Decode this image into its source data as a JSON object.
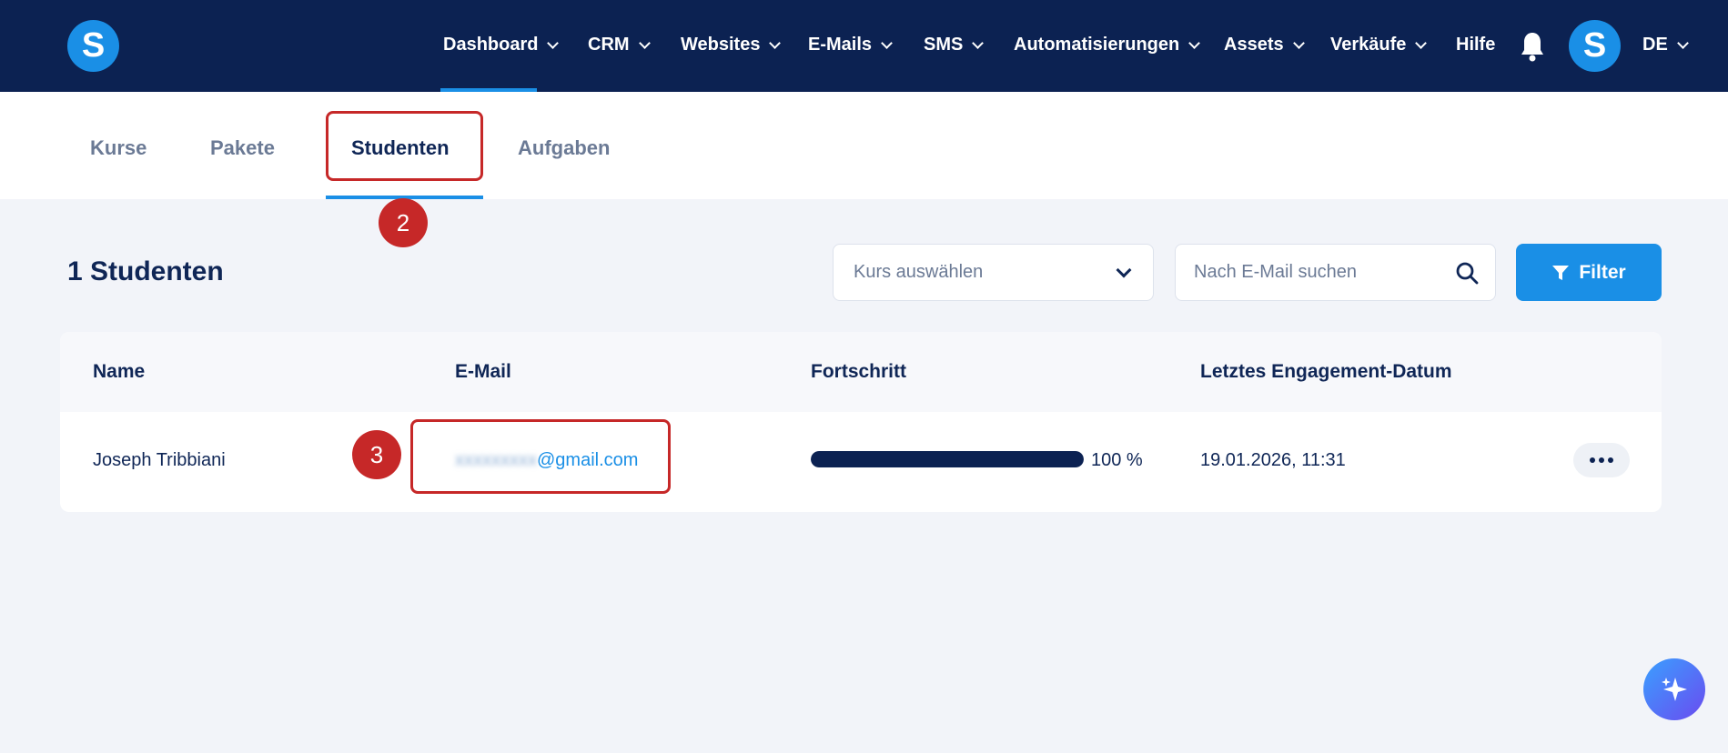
{
  "brand": {
    "logo_letter": "S"
  },
  "nav": {
    "items": [
      {
        "label": "Dashboard",
        "has_dropdown": true
      },
      {
        "label": "CRM",
        "has_dropdown": true
      },
      {
        "label": "Websites",
        "has_dropdown": true
      },
      {
        "label": "E-Mails",
        "has_dropdown": true
      },
      {
        "label": "SMS",
        "has_dropdown": true
      },
      {
        "label": "Automatisierungen",
        "has_dropdown": true
      },
      {
        "label": "Assets",
        "has_dropdown": true
      },
      {
        "label": "Verkäufe",
        "has_dropdown": true
      },
      {
        "label": "Hilfe",
        "has_dropdown": false
      }
    ],
    "avatar_letter": "S",
    "language": "DE"
  },
  "tabs": [
    "Kurse",
    "Pakete",
    "Studenten",
    "Aufgaben"
  ],
  "active_tab": "Studenten",
  "annotations": {
    "step_tab": "2",
    "step_email": "3"
  },
  "page": {
    "title": "1 Studenten",
    "course_select_placeholder": "Kurs auswählen",
    "search_placeholder": "Nach E-Mail suchen",
    "filter_label": "Filter"
  },
  "table": {
    "headers": [
      "Name",
      "E-Mail",
      "Fortschritt",
      "Letztes Engagement-Datum"
    ],
    "rows": [
      {
        "name": "Joseph Tribbiani",
        "email_local": "xxxxxxxxx",
        "email_domain": "@gmail.com",
        "progress": 100,
        "progress_label": "100 %",
        "last_engagement": "19.01.2026, 11:31"
      }
    ]
  },
  "colors": {
    "nav_bg": "#0c2252",
    "accent": "#1a8fe6",
    "annotation_red": "#c62828",
    "page_bg": "#f2f4f9"
  },
  "icons": {
    "bell": "bell-icon",
    "search": "search-icon",
    "filter": "filter-icon",
    "more": "more-horizontal-icon",
    "ai": "sparkle-icon"
  }
}
